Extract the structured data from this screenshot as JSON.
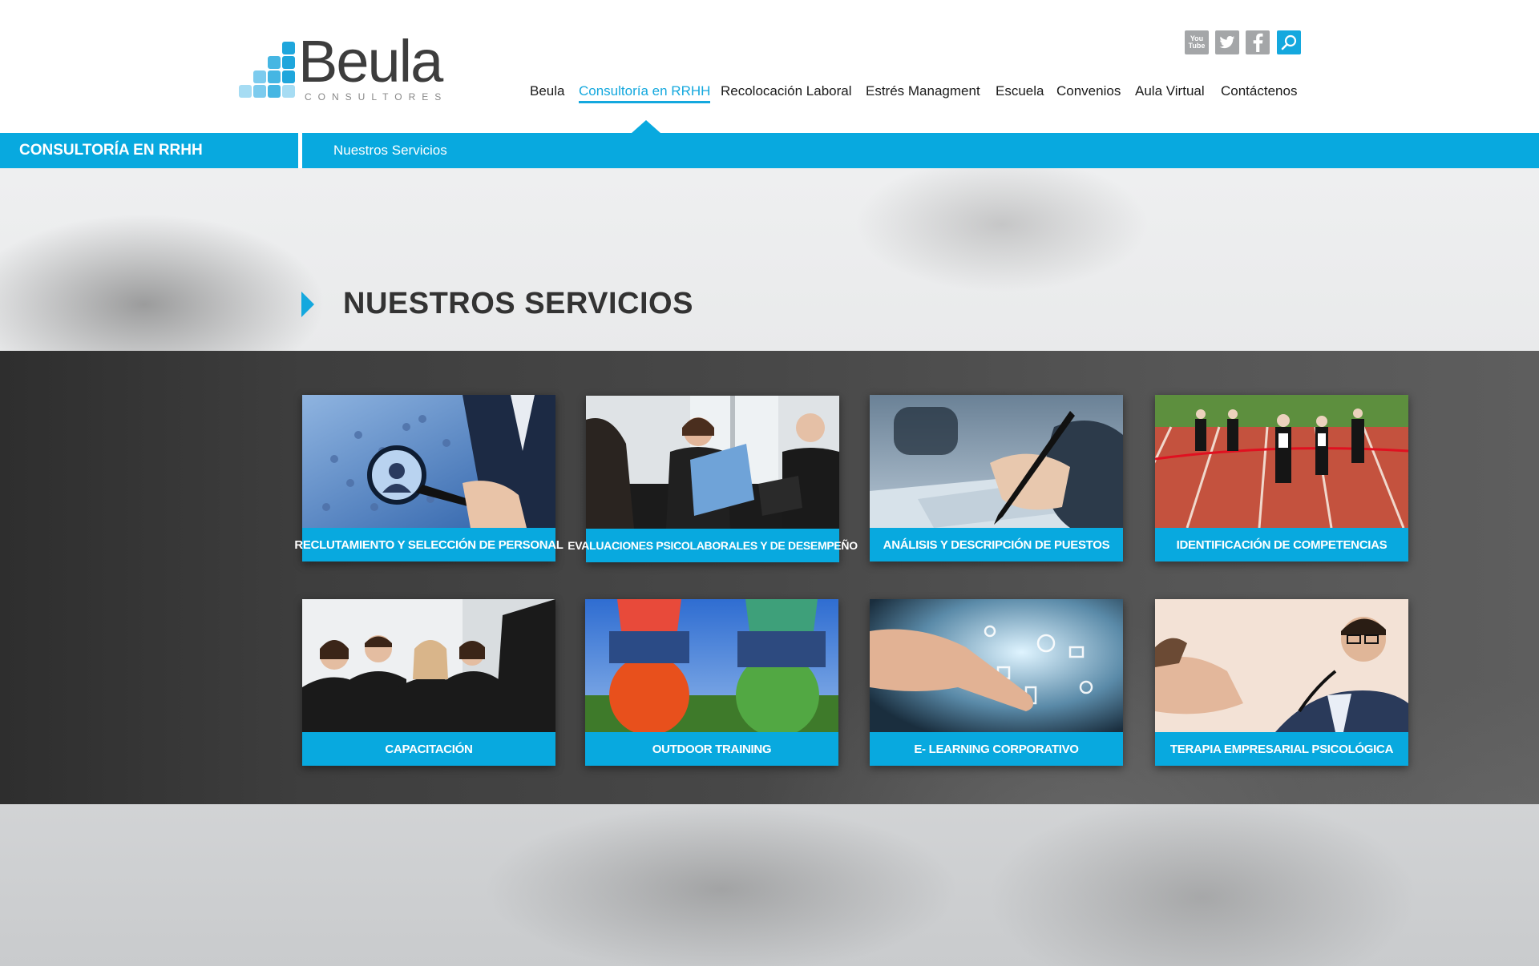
{
  "brand": {
    "name": "Beula",
    "tagline": "CONSULTORES"
  },
  "social": [
    {
      "name": "youtube-icon",
      "glyph": "You\nTube"
    },
    {
      "name": "twitter-icon",
      "glyph": "t"
    },
    {
      "name": "facebook-icon",
      "glyph": "f"
    },
    {
      "name": "search-icon",
      "glyph": "⚲"
    }
  ],
  "nav": {
    "items": [
      {
        "label": "Beula"
      },
      {
        "label": "Consultoría en RRHH",
        "active": true
      },
      {
        "label": "Recolocación Laboral"
      },
      {
        "label": "Estrés Managment"
      },
      {
        "label": "Escuela"
      },
      {
        "label": "Convenios"
      },
      {
        "label": "Aula Virtual"
      },
      {
        "label": "Contáctenos"
      }
    ]
  },
  "bluebar": {
    "section": "CONSULTORÍA EN RRHH",
    "breadcrumb": "Nuestros Servicios"
  },
  "page": {
    "title": "NUESTROS SERVICIOS"
  },
  "services": [
    {
      "label": "RECLUTAMIENTO Y SELECCIÓN DE PERSONAL"
    },
    {
      "label": "EVALUACIONES PSICOLABORALES Y DE DESEMPEÑO"
    },
    {
      "label": "ANÁLISIS Y DESCRIPCIÓN DE PUESTOS"
    },
    {
      "label": "IDENTIFICACIÓN DE COMPETENCIAS"
    },
    {
      "label": "CAPACITACIÓN"
    },
    {
      "label": "OUTDOOR TRAINING"
    },
    {
      "label": "E- LEARNING CORPORATIVO"
    },
    {
      "label": "TERAPIA EMPRESARIAL PSICOLÓGICA"
    }
  ],
  "colors": {
    "accent": "#08a9df",
    "text_dark": "#333333"
  }
}
